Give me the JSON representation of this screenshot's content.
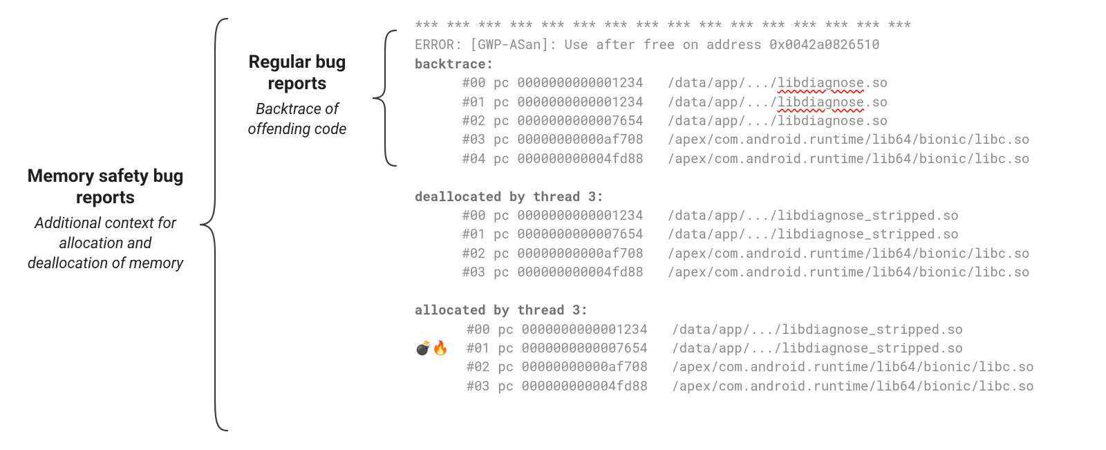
{
  "labels": {
    "memory_safety": {
      "title": "Memory safety bug reports",
      "subtitle": "Additional context for allocation and deallocation of memory"
    },
    "regular": {
      "title": "Regular bug reports",
      "subtitle": "Backtrace of offending code"
    }
  },
  "code": {
    "asterisks": "*** *** *** *** *** *** *** *** *** *** *** *** *** *** *** ***",
    "error": "ERROR: [GWP-ASan]: Use after free on address 0x0042a0826510",
    "backtrace_header": "backtrace:",
    "backtrace": [
      {
        "frame": "#00",
        "pc": "pc 0000000000001234",
        "path": "/data/app/.../",
        "lib": "libdiagnose",
        "ext": ".so",
        "wavy": true
      },
      {
        "frame": "#01",
        "pc": "pc 0000000000001234",
        "path": "/data/app/.../",
        "lib": "libdiagnose",
        "ext": ".so",
        "wavy": true
      },
      {
        "frame": "#02",
        "pc": "pc 0000000000007654",
        "path": "/data/app/.../libdiagnose.so",
        "lib": "",
        "ext": "",
        "wavy": false
      },
      {
        "frame": "#03",
        "pc": "pc 00000000000af708",
        "path": "/apex/com.android.runtime/lib64/bionic/libc.so",
        "lib": "",
        "ext": "",
        "wavy": false
      },
      {
        "frame": "#04",
        "pc": "pc 000000000004fd88",
        "path": "/apex/com.android.runtime/lib64/bionic/libc.so",
        "lib": "",
        "ext": "",
        "wavy": false
      }
    ],
    "dealloc_header": "deallocated by thread 3:",
    "dealloc": [
      {
        "frame": "#00",
        "pc": "pc 0000000000001234",
        "path": "/data/app/.../libdiagnose_stripped.so"
      },
      {
        "frame": "#01",
        "pc": "pc 0000000000007654",
        "path": "/data/app/.../libdiagnose_stripped.so"
      },
      {
        "frame": "#02",
        "pc": "pc 00000000000af708",
        "path": "/apex/com.android.runtime/lib64/bionic/libc.so"
      },
      {
        "frame": "#03",
        "pc": "pc 000000000004fd88",
        "path": "/apex/com.android.runtime/lib64/bionic/libc.so"
      }
    ],
    "alloc_header": "allocated by thread 3:",
    "alloc": [
      {
        "prefix": "   ",
        "frame": "#00",
        "pc": "pc 0000000000001234",
        "path": "/data/app/.../libdiagnose_stripped.so"
      },
      {
        "prefix": "💣🔥 ",
        "frame": "#01",
        "pc": "pc 0000000000007654",
        "path": "/data/app/.../libdiagnose_stripped.so"
      },
      {
        "prefix": "   ",
        "frame": "#02",
        "pc": "pc 00000000000af708",
        "path": "/apex/com.android.runtime/lib64/bionic/libc.so"
      },
      {
        "prefix": "   ",
        "frame": "#03",
        "pc": "pc 000000000004fd88",
        "path": "/apex/com.android.runtime/lib64/bionic/libc.so"
      }
    ]
  }
}
